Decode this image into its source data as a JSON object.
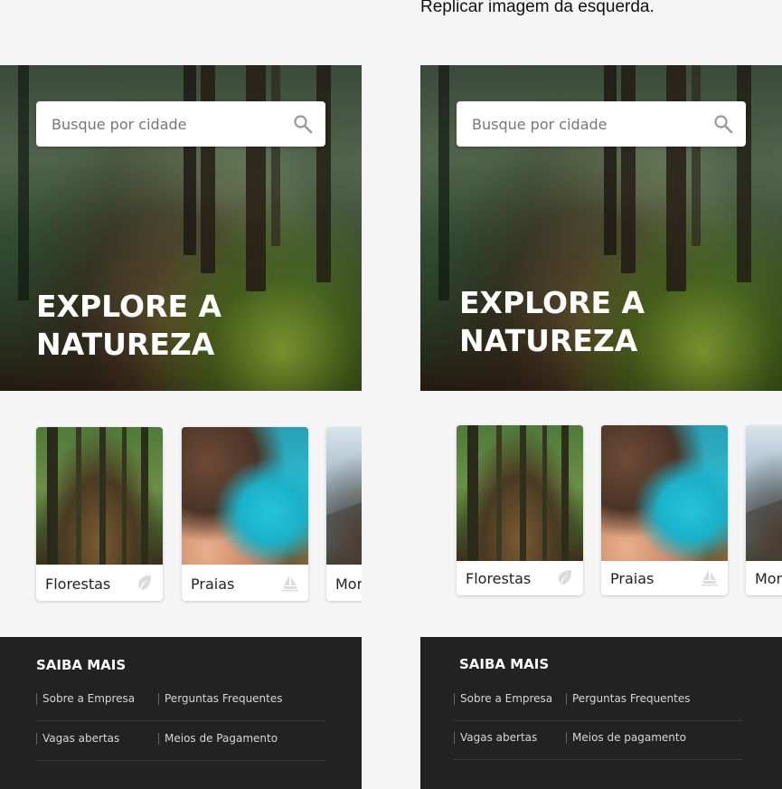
{
  "note": "Replicar imagem da esquerda.",
  "left": {
    "search": {
      "placeholder": "Busque por cidade"
    },
    "hero": {
      "title_line1": "EXPLORE A",
      "title_line2": "NATUREZA"
    },
    "cards": [
      {
        "label": "Florestas",
        "icon": "leaf-icon"
      },
      {
        "label": "Praias",
        "icon": "sailboat-icon"
      },
      {
        "label": "Montanhas",
        "icon": "mountain-icon"
      }
    ],
    "footer": {
      "title": "SAIBA MAIS",
      "links": [
        [
          "Sobre a Empresa",
          "Perguntas Frequentes"
        ],
        [
          "Vagas abertas",
          "Meios de Pagamento"
        ]
      ]
    }
  },
  "right": {
    "search": {
      "placeholder": "Busque por cidade"
    },
    "hero": {
      "title_line1": "EXPLORE A",
      "title_line2": "NATUREZA"
    },
    "cards": [
      {
        "label": "Florestas",
        "icon": "leaf-icon"
      },
      {
        "label": "Praias",
        "icon": "sailboat-icon"
      },
      {
        "label": "Montanhas",
        "icon": "mountain-icon"
      }
    ],
    "footer": {
      "title": "SAIBA MAIS",
      "links": [
        [
          "Sobre a Empresa",
          "Perguntas Frequentes"
        ],
        [
          "Vagas abertas",
          "Meios de pagamento"
        ]
      ]
    }
  }
}
